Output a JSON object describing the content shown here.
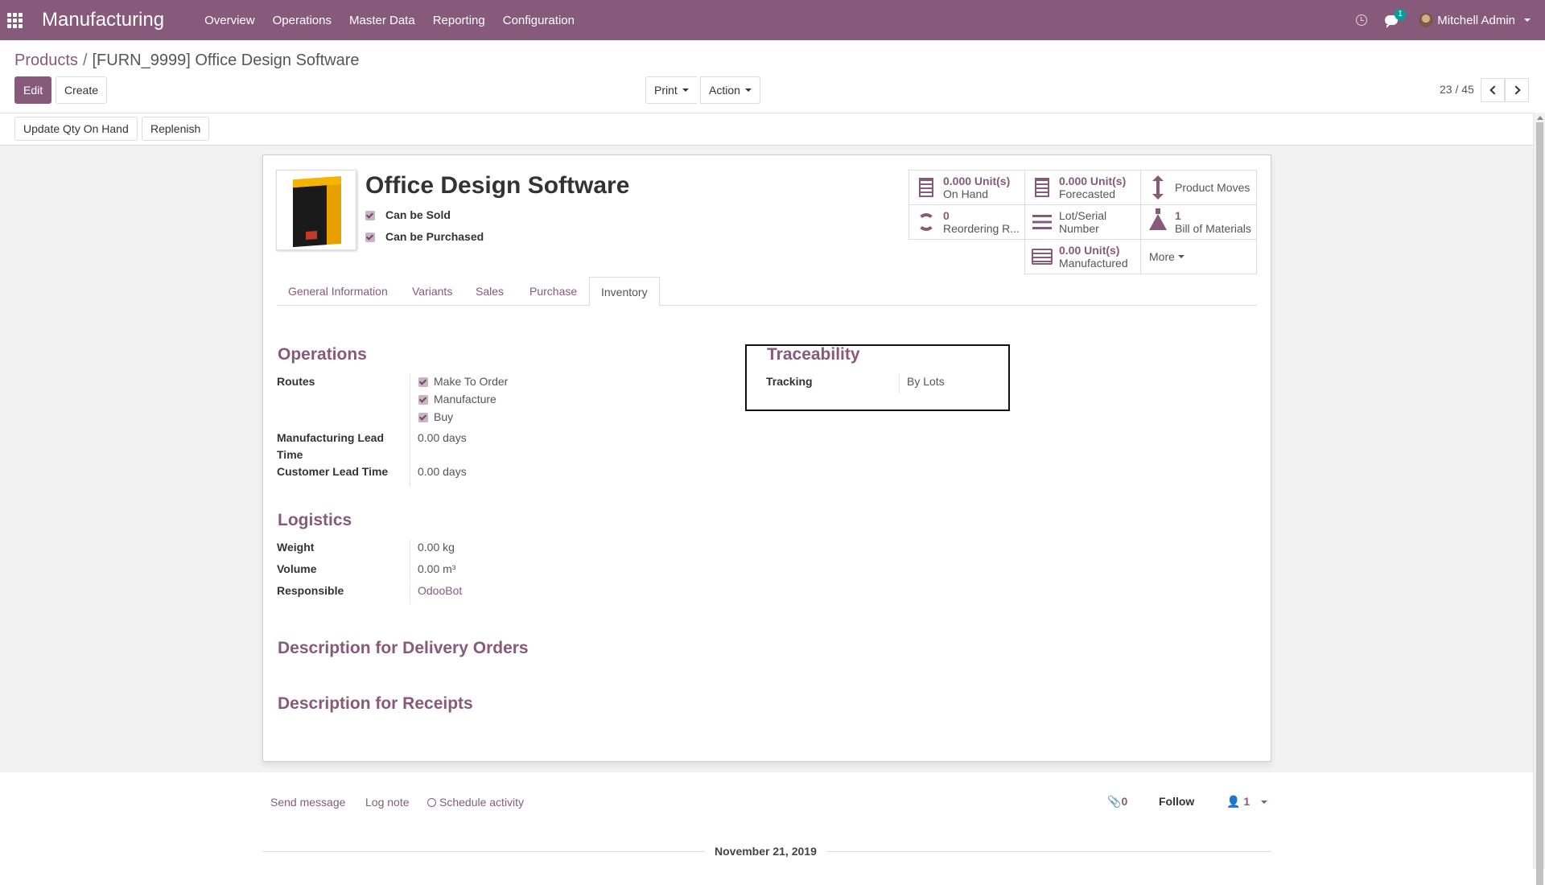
{
  "navbar": {
    "app_name": "Manufacturing",
    "menu": [
      "Overview",
      "Operations",
      "Master Data",
      "Reporting",
      "Configuration"
    ],
    "messages_badge": "1",
    "user_name": "Mitchell Admin",
    "color": "#875a7b"
  },
  "breadcrumb": {
    "parent": "Products",
    "separator": "/",
    "current": "[FURN_9999] Office Design Software"
  },
  "control_panel": {
    "edit_label": "Edit",
    "create_label": "Create",
    "print_label": "Print",
    "action_label": "Action",
    "pager": "23 / 45"
  },
  "statusbar": {
    "update_qty_label": "Update Qty On Hand",
    "replenish_label": "Replenish"
  },
  "product": {
    "name": "Office Design Software",
    "can_be_sold_label": "Can be Sold",
    "can_be_purchased_label": "Can be Purchased"
  },
  "smart_buttons": {
    "on_hand": {
      "value": "0.000 Unit(s)",
      "label": "On Hand"
    },
    "forecasted": {
      "value": "0.000 Unit(s)",
      "label": "Forecasted"
    },
    "product_moves": {
      "label": "Product Moves"
    },
    "reordering": {
      "value": "0",
      "label": "Reordering R..."
    },
    "lot_serial": {
      "label1": "Lot/Serial",
      "label2": "Number"
    },
    "bom": {
      "value": "1",
      "label": "Bill of Materials"
    },
    "manufactured": {
      "value": "0.00 Unit(s)",
      "label": "Manufactured"
    },
    "more_label": "More"
  },
  "tabs": [
    "General Information",
    "Variants",
    "Sales",
    "Purchase",
    "Inventory"
  ],
  "active_tab": "Inventory",
  "operations": {
    "title": "Operations",
    "routes_label": "Routes",
    "routes": [
      "Make To Order",
      "Manufacture",
      "Buy"
    ],
    "mfg_lead_label_1": "Manufacturing Lead",
    "mfg_lead_label_2": "Time",
    "mfg_lead_value": "0.00 days",
    "customer_lead_label": "Customer Lead Time",
    "customer_lead_value": "0.00 days"
  },
  "traceability": {
    "title": "Traceability",
    "tracking_label": "Tracking",
    "tracking_value": "By Lots"
  },
  "logistics": {
    "title": "Logistics",
    "weight_label": "Weight",
    "weight_value": "0.00",
    "weight_unit": "kg",
    "volume_label": "Volume",
    "volume_value": "0.00",
    "volume_unit": "m³",
    "responsible_label": "Responsible",
    "responsible_value": "OdooBot"
  },
  "descriptions": {
    "delivery": "Description for Delivery Orders",
    "receipts": "Description for Receipts"
  },
  "chatter": {
    "send_message": "Send message",
    "log_note": "Log note",
    "schedule_activity": "Schedule activity",
    "attachments": "0",
    "follow": "Follow",
    "followers": "1",
    "date": "November 21, 2019"
  }
}
